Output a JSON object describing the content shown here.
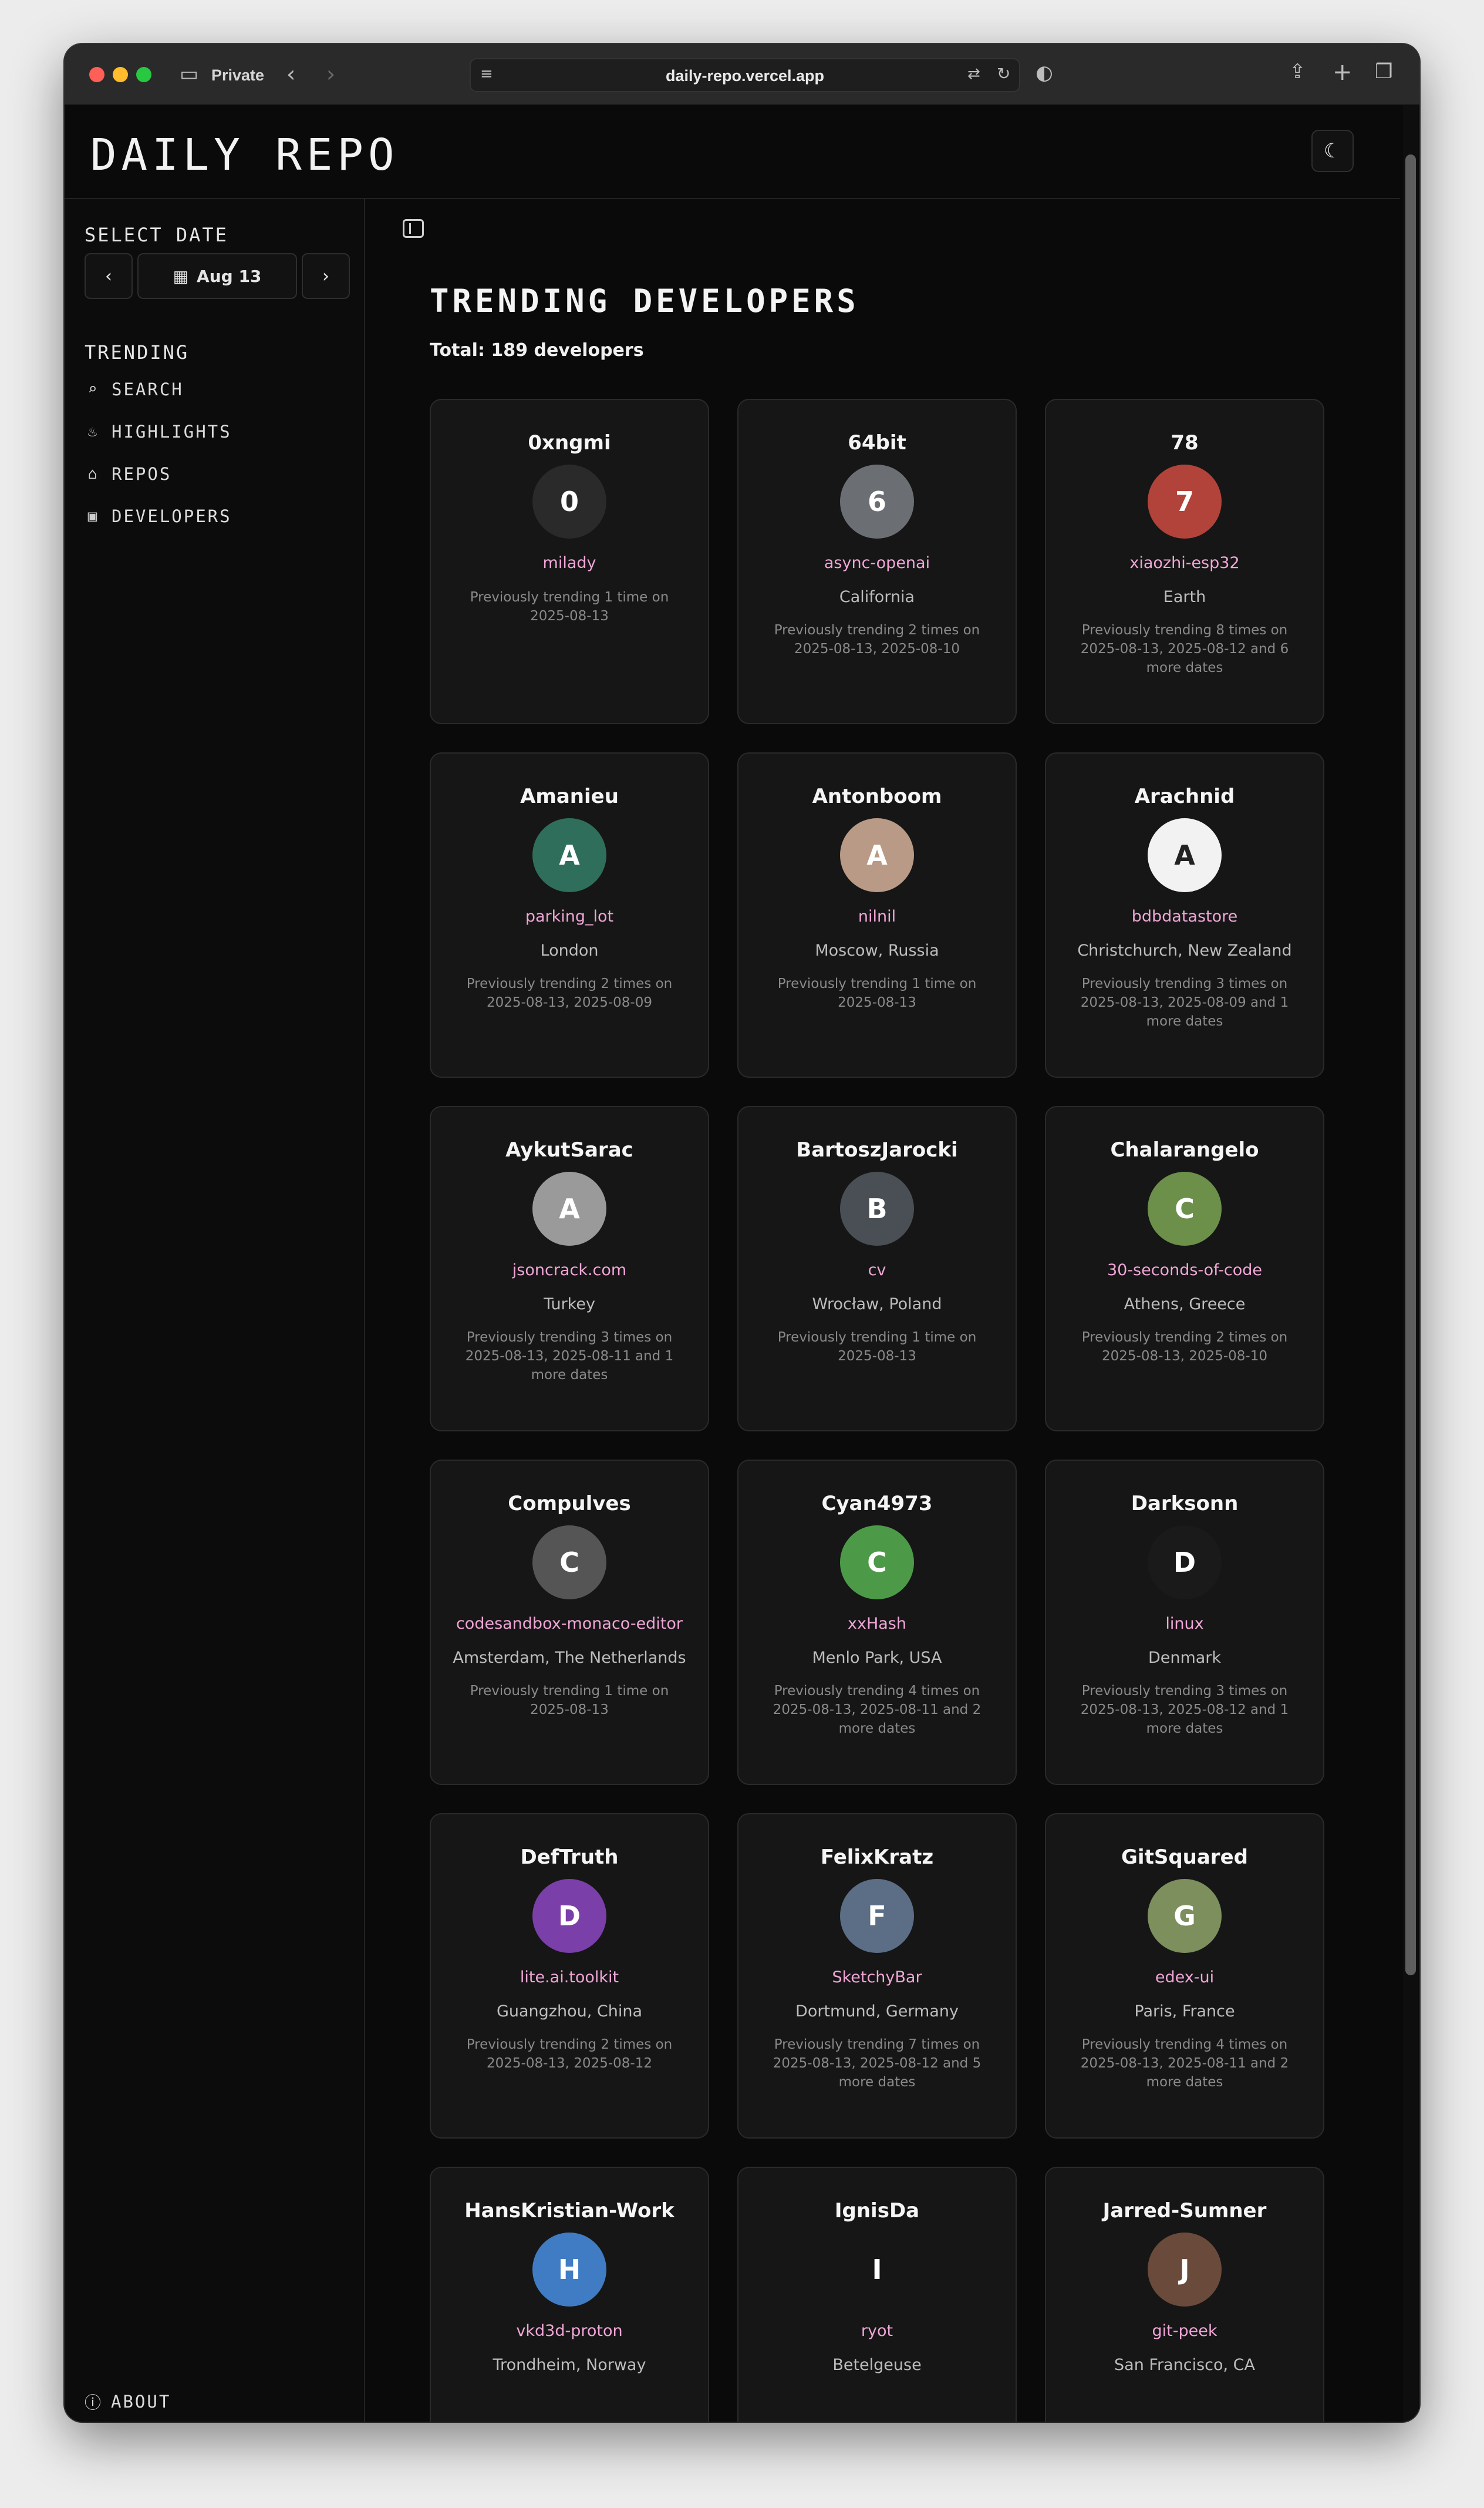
{
  "browser": {
    "private_label": "Private",
    "url": "daily-repo.vercel.app"
  },
  "site": {
    "logo": "DAILY REPO"
  },
  "sidebar": {
    "select_date_label": "SELECT DATE",
    "date_value": "Aug 13",
    "nav_group_title": "TRENDING",
    "nav_items": [
      {
        "label": "SEARCH",
        "icon": "search-icon"
      },
      {
        "label": "HIGHLIGHTS",
        "icon": "flame-icon"
      },
      {
        "label": "REPOS",
        "icon": "home-icon"
      },
      {
        "label": "DEVELOPERS",
        "icon": "contact-icon"
      }
    ],
    "about_label": "ABOUT"
  },
  "main": {
    "title": "TRENDING DEVELOPERS",
    "total": "Total: 189 developers"
  },
  "developers": [
    {
      "name": "0xngmi",
      "repo": "milady",
      "location": "",
      "history": "Previously trending 1 time on 2025-08-13",
      "avatar_color": "#2a2a2a",
      "avatar_initial": "0"
    },
    {
      "name": "64bit",
      "repo": "async-openai",
      "location": "California",
      "history": "Previously trending 2 times on 2025-08-13, 2025-08-10",
      "avatar_color": "#6b6f73",
      "avatar_initial": "6"
    },
    {
      "name": "78",
      "repo": "xiaozhi-esp32",
      "location": "Earth",
      "history": "Previously trending 8 times on 2025-08-13, 2025-08-12 and 6 more dates",
      "avatar_color": "#b2433a",
      "avatar_initial": "7"
    },
    {
      "name": "Amanieu",
      "repo": "parking_lot",
      "location": "London",
      "history": "Previously trending 2 times on 2025-08-13, 2025-08-09",
      "avatar_color": "#2f6e5a",
      "avatar_initial": "A"
    },
    {
      "name": "Antonboom",
      "repo": "nilnil",
      "location": "Moscow, Russia",
      "history": "Previously trending 1 time on 2025-08-13",
      "avatar_color": "#b89a86",
      "avatar_initial": "A"
    },
    {
      "name": "Arachnid",
      "repo": "bdbdatastore",
      "location": "Christchurch, New Zealand",
      "history": "Previously trending 3 times on 2025-08-13, 2025-08-09 and 1 more dates",
      "avatar_color": "#f2f2f2",
      "avatar_initial": "A"
    },
    {
      "name": "AykutSarac",
      "repo": "jsoncrack.com",
      "location": "Turkey",
      "history": "Previously trending 3 times on 2025-08-13, 2025-08-11 and 1 more dates",
      "avatar_color": "#9a9a9a",
      "avatar_initial": "A"
    },
    {
      "name": "BartoszJarocki",
      "repo": "cv",
      "location": "Wrocław, Poland",
      "history": "Previously trending 1 time on 2025-08-13",
      "avatar_color": "#4a4f55",
      "avatar_initial": "B"
    },
    {
      "name": "Chalarangelo",
      "repo": "30-seconds-of-code",
      "location": "Athens, Greece",
      "history": "Previously trending 2 times on 2025-08-13, 2025-08-10",
      "avatar_color": "#6c8f4a",
      "avatar_initial": "C"
    },
    {
      "name": "Compulves",
      "repo": "codesandbox-monaco-editor",
      "location": "Amsterdam, The Netherlands",
      "history": "Previously trending 1 time on 2025-08-13",
      "avatar_color": "#555555",
      "avatar_initial": "C"
    },
    {
      "name": "Cyan4973",
      "repo": "xxHash",
      "location": "Menlo Park, USA",
      "history": "Previously trending 4 times on 2025-08-13, 2025-08-11 and 2 more dates",
      "avatar_color": "#4c9a48",
      "avatar_initial": "C"
    },
    {
      "name": "Darksonn",
      "repo": "linux",
      "location": "Denmark",
      "history": "Previously trending 3 times on 2025-08-13, 2025-08-12 and 1 more dates",
      "avatar_color": "#1a1a1a",
      "avatar_initial": "D"
    },
    {
      "name": "DefTruth",
      "repo": "lite.ai.toolkit",
      "location": "Guangzhou, China",
      "history": "Previously trending 2 times on 2025-08-13, 2025-08-12",
      "avatar_color": "#7a3fa8",
      "avatar_initial": "D"
    },
    {
      "name": "FelixKratz",
      "repo": "SketchyBar",
      "location": "Dortmund, Germany",
      "history": "Previously trending 7 times on 2025-08-13, 2025-08-12 and 5 more dates",
      "avatar_color": "#5b6e86",
      "avatar_initial": "F"
    },
    {
      "name": "GitSquared",
      "repo": "edex-ui",
      "location": "Paris, France",
      "history": "Previously trending 4 times on 2025-08-13, 2025-08-11 and 2 more dates",
      "avatar_color": "#7c8f5c",
      "avatar_initial": "G"
    },
    {
      "name": "HansKristian-Work",
      "repo": "vkd3d-proton",
      "location": "Trondheim, Norway",
      "history": "",
      "avatar_color": "#3f7cc4",
      "avatar_initial": "H"
    },
    {
      "name": "IgnisDa",
      "repo": "ryot",
      "location": "Betelgeuse",
      "history": "",
      "avatar_color": "#161616",
      "avatar_initial": "I"
    },
    {
      "name": "Jarred-Sumner",
      "repo": "git-peek",
      "location": "San Francisco, CA",
      "history": "",
      "avatar_color": "#6a4a3a",
      "avatar_initial": "J"
    }
  ]
}
